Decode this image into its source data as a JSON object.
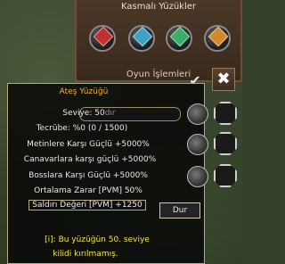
{
  "ring_window": {
    "title": "Kasmalı Yüzükler",
    "footer": "Oyun İşlemleri"
  },
  "tooltip": {
    "item_name": "Ateş Yüzüğü",
    "level_label": "Seviye: 50",
    "level_unit": "dır",
    "experience": "Tecrübe: %0 (0 / 1500)",
    "stats": [
      "Metinlere Karşı Güçlü +5000%",
      "Canavarlara karşı güçlü +5000%",
      "Bosslara Karşı Güçlü +5000%",
      "Ortalama Zarar [PVM] 50%",
      "Saldırı Değeri [PVM] +1250"
    ],
    "notice_line1": "[i]: Bu yüzüğün 50. seviye",
    "notice_line2": "kilidi kırılmamış."
  },
  "buttons": {
    "stop_label": "Dur",
    "close_glyph": "✖",
    "check_glyph": "✔"
  },
  "colors": {
    "gold": "#f0b341",
    "yellow": "#f0e650",
    "border": "#b8a982"
  }
}
